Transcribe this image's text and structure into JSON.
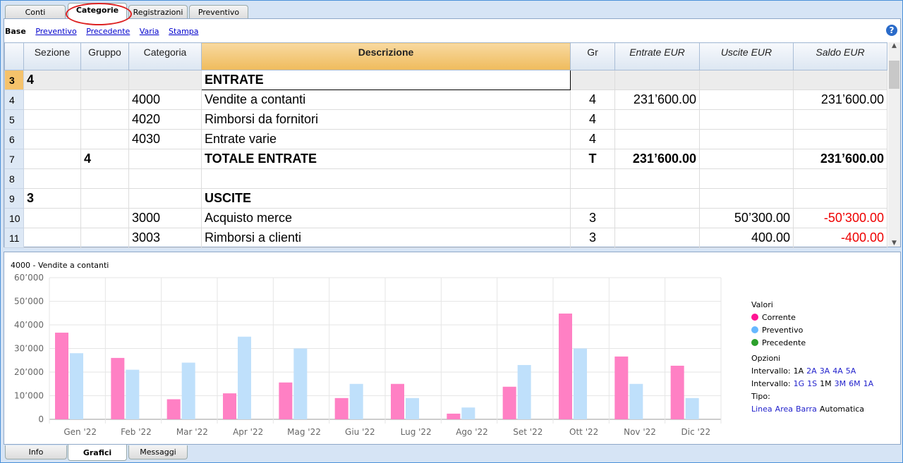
{
  "top_tabs": [
    {
      "label": "Conti"
    },
    {
      "label": "Categorie",
      "active": true
    },
    {
      "label": "Registrazioni"
    },
    {
      "label": "Preventivo"
    }
  ],
  "subviews": {
    "base": "Base",
    "links": [
      "Preventivo",
      "Precedente",
      "Varia",
      "Stampa"
    ],
    "help_icon": "?"
  },
  "table": {
    "headers": [
      "",
      "Sezione",
      "Gruppo",
      "Categoria",
      "Descrizione",
      "Gr",
      "Entrate EUR",
      "Uscite EUR",
      "Saldo EUR"
    ],
    "rows": [
      [
        "3",
        "4",
        "",
        "",
        "ENTRATE",
        "",
        "",
        "",
        ""
      ],
      [
        "4",
        "",
        "",
        "4000",
        "Vendite a contanti",
        "4",
        "231’600.00",
        "",
        "231’600.00"
      ],
      [
        "5",
        "",
        "",
        "4020",
        "Rimborsi da fornitori",
        "4",
        "",
        "",
        ""
      ],
      [
        "6",
        "",
        "",
        "4030",
        "Entrate varie",
        "4",
        "",
        "",
        ""
      ],
      [
        "7",
        "",
        "4",
        "",
        "TOTALE ENTRATE",
        "T",
        "231’600.00",
        "",
        "231’600.00"
      ],
      [
        "8",
        "",
        "",
        "",
        "",
        "",
        "",
        "",
        ""
      ],
      [
        "9",
        "3",
        "",
        "",
        "USCITE",
        "",
        "",
        "",
        ""
      ],
      [
        "10",
        "",
        "",
        "3000",
        "Acquisto merce",
        "3",
        "",
        "50’300.00",
        "-50’300.00"
      ],
      [
        "11",
        "",
        "",
        "3003",
        "Rimborsi a clienti",
        "3",
        "",
        "400.00",
        "-400.00"
      ]
    ]
  },
  "chart_data": {
    "type": "bar",
    "title": "4000 - Vendite a contanti",
    "categories": [
      "Gen '22",
      "Feb '22",
      "Mar '22",
      "Apr '22",
      "Mag '22",
      "Giu '22",
      "Lug '22",
      "Ago '22",
      "Set '22",
      "Ott '22",
      "Nov '22",
      "Dic '22"
    ],
    "series": [
      {
        "name": "Corrente",
        "color": "#ff80c4",
        "values": [
          36700,
          26000,
          8500,
          11000,
          15600,
          9000,
          15000,
          2400,
          13800,
          44800,
          26600,
          22700
        ]
      },
      {
        "name": "Preventivo",
        "color": "#bfe0fb",
        "values": [
          28000,
          21000,
          24000,
          35000,
          30000,
          15000,
          9000,
          5000,
          23000,
          30000,
          15000,
          9000
        ]
      }
    ],
    "ylim": [
      0,
      60000
    ],
    "yticks": [
      "0",
      "10’000",
      "20’000",
      "30’000",
      "40’000",
      "50’000",
      "60’000"
    ],
    "grid": true,
    "legend": "right"
  },
  "legend": {
    "title": "Valori",
    "items": [
      {
        "label": "Corrente",
        "color": "#ff1493"
      },
      {
        "label": "Preventivo",
        "color": "#66b8ff"
      },
      {
        "label": "Precedente",
        "color": "#2ca02c"
      }
    ],
    "options_title": "Opzioni",
    "interval1_label": "Intervallo:",
    "interval1": [
      "1A",
      "2A",
      "3A",
      "4A",
      "5A"
    ],
    "interval2_label": "Intervallo:",
    "interval2": [
      "1G",
      "1S",
      "1M",
      "3M",
      "6M",
      "1A"
    ],
    "type_label": "Tipo:",
    "types": [
      "Linea",
      "Area",
      "Barra",
      "Automatica"
    ]
  },
  "bottom_tabs": [
    {
      "label": "Info"
    },
    {
      "label": "Grafici",
      "active": true
    },
    {
      "label": "Messaggi"
    }
  ]
}
